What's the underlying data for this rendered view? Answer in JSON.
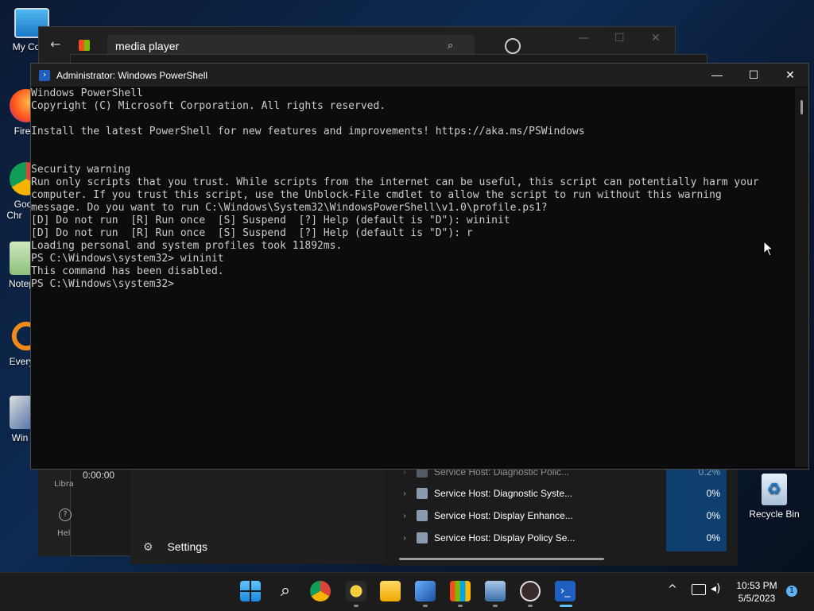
{
  "desktop": {
    "icons": [
      {
        "label": "My Com",
        "icon": "monitor-icon"
      },
      {
        "label": "Fire",
        "icon": "firefox-icon"
      },
      {
        "label": "Goo\nChr",
        "icon": "chrome-icon"
      },
      {
        "label": "Notep",
        "icon": "notepad-icon"
      },
      {
        "label": "Every",
        "icon": "everything-icon"
      },
      {
        "label": "Win",
        "icon": "app-icon"
      }
    ],
    "recycle_bin": "Recycle Bin"
  },
  "store_window": {
    "search_value": "media player"
  },
  "media_player": {
    "time": "0:00:00",
    "side_library": "Libra",
    "side_help": "Hel",
    "settings": "Settings"
  },
  "task_manager": {
    "rows": [
      {
        "name": "Service Host: Diagnostic Polic...",
        "cpu": "0.2%"
      },
      {
        "name": "Service Host: Diagnostic Syste...",
        "cpu": "0%"
      },
      {
        "name": "Service Host: Display Enhance...",
        "cpu": "0%"
      },
      {
        "name": "Service Host: Display Policy Se...",
        "cpu": "0%"
      }
    ]
  },
  "powershell": {
    "title": "Administrator: Windows PowerShell",
    "lines": [
      "Windows PowerShell",
      "Copyright (C) Microsoft Corporation. All rights reserved.",
      "",
      "Install the latest PowerShell for new features and improvements! https://aka.ms/PSWindows",
      "",
      "",
      "Security warning",
      "Run only scripts that you trust. While scripts from the internet can be useful, this script can potentially harm your",
      "computer. If you trust this script, use the Unblock-File cmdlet to allow the script to run without this warning",
      "message. Do you want to run C:\\Windows\\System32\\WindowsPowerShell\\v1.0\\profile.ps1?",
      "[D] Do not run  [R] Run once  [S] Suspend  [?] Help (default is \"D\"): wininit",
      "[D] Do not run  [R] Run once  [S] Suspend  [?] Help (default is \"D\"): r",
      "Loading personal and system profiles took 11892ms.",
      "PS C:\\Windows\\system32> wininit",
      "This command has been disabled.",
      "PS C:\\Windows\\system32>"
    ]
  },
  "taskbar": {
    "apps": [
      "start-icon",
      "search-icon",
      "chrome-icon",
      "bee-icon",
      "file-explorer-icon",
      "remote-icon",
      "store-icon",
      "resource-monitor-icon",
      "media-player-icon",
      "powershell-icon"
    ],
    "time": "10:53 PM",
    "date": "5/5/2023",
    "notification_count": "1"
  },
  "colors": {
    "console_bg": "#0c0c0c",
    "console_text": "#cccccc",
    "taskbar_bg": "#1c1c1c",
    "accent": "#0078d4"
  }
}
